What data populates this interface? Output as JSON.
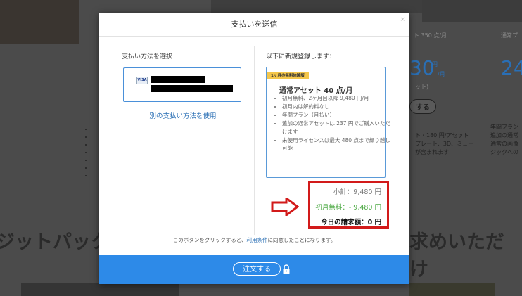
{
  "background": {
    "price1_label": "ト 350 点/月",
    "price2_label": "通常プ",
    "price1_num": "30",
    "price1_unit": "円",
    "price1_per": "/月",
    "price1_sub": "ット)",
    "price2_num": "24",
    "buy_button": "する",
    "bg_list_a": [
      "ト・180 円/アセット",
      "プレート、3D、ミュー",
      "が含まれます"
    ],
    "bg_list_b": [
      "年間プラン",
      "追加の通常",
      "通常の画像",
      "ジックへの"
    ],
    "bg_heading_left": "ジットパック",
    "bg_heading_right": "求めいただけ"
  },
  "modal": {
    "title": "支払いを送信",
    "close_label": "×",
    "left": {
      "title": "支払い方法を選択",
      "card_brand": "VISA",
      "alt_payment_link": "別の支払い方法を使用"
    },
    "right": {
      "title": "以下に新規登録します：",
      "trial_badge": "1ヶ月の無料体験版",
      "plan_name": "通常アセット 40 点/月",
      "plan_features": [
        "初月無料、2ヶ月目以降 9,480 円/月",
        "初月内は解約料なし",
        "年間プラン（月払い）",
        "追加の通常アセットは 237 円でご購入いただけます",
        "未使用ライセンスは最大 480 点まで繰り越し可能"
      ],
      "subtotal": "小計：9,480 円",
      "discount": "初月無料：- 9,480 円",
      "today_total": "今日の請求額：0 円"
    },
    "agreement": {
      "prefix": "このボタンをクリックすると、",
      "terms_link": "利用条件",
      "suffix": "に同意したことになります。"
    },
    "footer": {
      "order_button": "注文する"
    }
  },
  "colors": {
    "accent_blue": "#2d8ae8",
    "link_blue": "#2a6fb5",
    "discount_green": "#4eaa45",
    "highlight_red": "#d21a1a",
    "badge_yellow": "#f4c64a"
  }
}
